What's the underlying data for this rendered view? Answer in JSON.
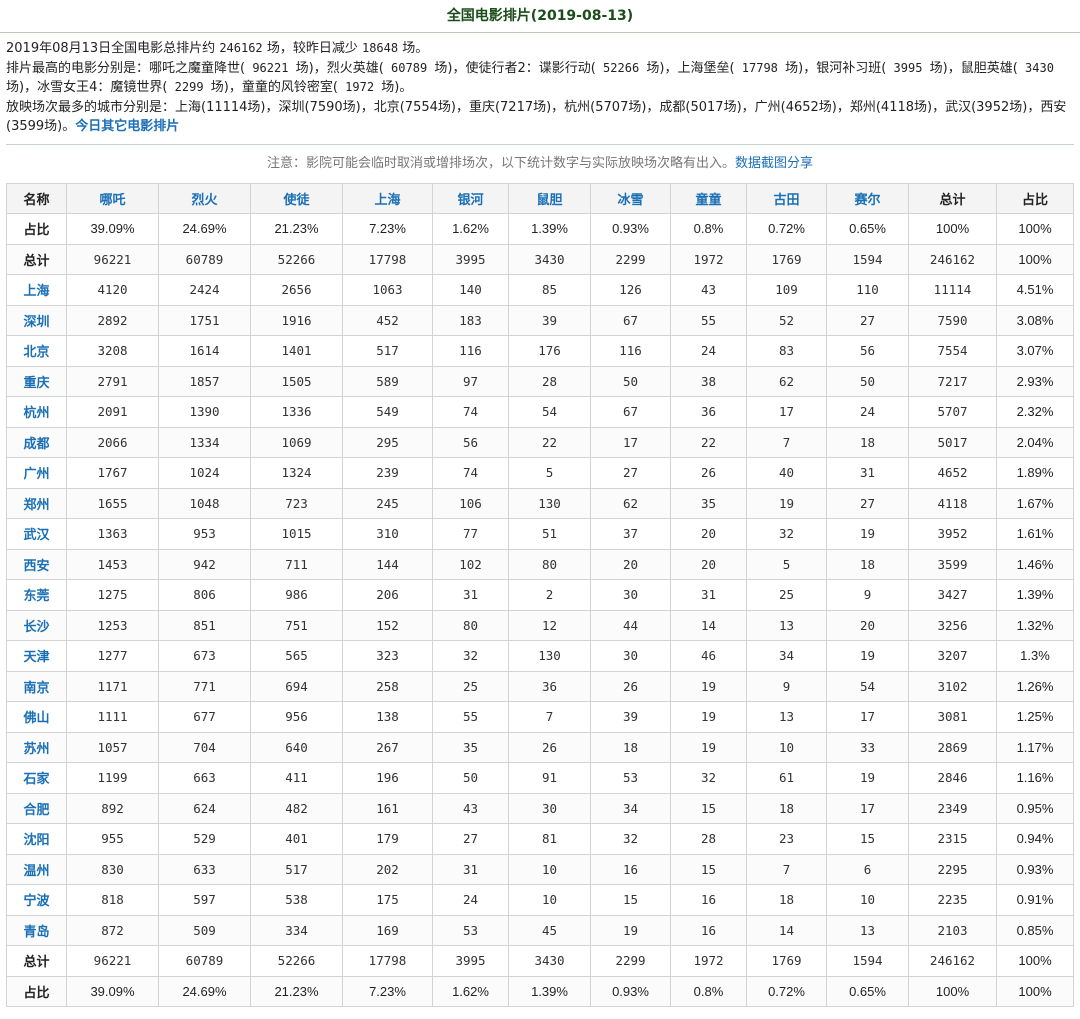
{
  "page_title": "全国电影排片(2019-08-13)",
  "summary": {
    "line1_a": "2019年08月13日全国电影总排片约",
    "total": "246162",
    "line1_b": "场，较昨日减少",
    "diff": "18648",
    "line1_c": "场。",
    "films_intro": "排片最高的电影分别是：",
    "films": [
      {
        "name": "哪吒之魔童降世",
        "count": "96221"
      },
      {
        "name": "烈火英雄",
        "count": "60789"
      },
      {
        "name": "使徒行者2：谍影行动",
        "count": "52266"
      },
      {
        "name": "上海堡垒",
        "count": "17798"
      },
      {
        "name": "银河补习班",
        "count": "3995"
      },
      {
        "name": "鼠胆英雄",
        "count": "3430"
      },
      {
        "name": "冰雪女王4：魔镜世界",
        "count": "2299"
      },
      {
        "name": "童童的风铃密室",
        "count": "1972"
      }
    ],
    "cities_line": "放映场次最多的城市分别是：上海(11114场)，深圳(7590场)，北京(7554场)，重庆(7217场)，杭州(5707场)，成都(5017场)，广州(4652场)，郑州(4118场)，武汉(3952场)，西安(3599场)。",
    "other_link": "今日其它电影排片"
  },
  "notice": {
    "text": "注意：影院可能会临时取消或增排场次，以下统计数字与实际放映场次略有出入。",
    "link": "数据截图分享"
  },
  "table": {
    "header": [
      "名称",
      "哪吒",
      "烈火",
      "使徒",
      "上海",
      "银河",
      "鼠胆",
      "冰雪",
      "童童",
      "古田",
      "赛尔",
      "总计",
      "占比"
    ],
    "top_rows": [
      {
        "label": "占比",
        "values": [
          "39.09%",
          "24.69%",
          "21.23%",
          "7.23%",
          "1.62%",
          "1.39%",
          "0.93%",
          "0.8%",
          "0.72%",
          "0.65%",
          "100%",
          "100%"
        ],
        "pct": true
      },
      {
        "label": "总计",
        "values": [
          "96221",
          "60789",
          "52266",
          "17798",
          "3995",
          "3430",
          "2299",
          "1972",
          "1769",
          "1594",
          "246162",
          "100%"
        ],
        "pct": false
      }
    ],
    "city_rows": [
      {
        "city": "上海",
        "values": [
          "4120",
          "2424",
          "2656",
          "1063",
          "140",
          "85",
          "126",
          "43",
          "109",
          "110",
          "11114"
        ],
        "share": "4.51%"
      },
      {
        "city": "深圳",
        "values": [
          "2892",
          "1751",
          "1916",
          "452",
          "183",
          "39",
          "67",
          "55",
          "52",
          "27",
          "7590"
        ],
        "share": "3.08%"
      },
      {
        "city": "北京",
        "values": [
          "3208",
          "1614",
          "1401",
          "517",
          "116",
          "176",
          "116",
          "24",
          "83",
          "56",
          "7554"
        ],
        "share": "3.07%"
      },
      {
        "city": "重庆",
        "values": [
          "2791",
          "1857",
          "1505",
          "589",
          "97",
          "28",
          "50",
          "38",
          "62",
          "50",
          "7217"
        ],
        "share": "2.93%"
      },
      {
        "city": "杭州",
        "values": [
          "2091",
          "1390",
          "1336",
          "549",
          "74",
          "54",
          "67",
          "36",
          "17",
          "24",
          "5707"
        ],
        "share": "2.32%"
      },
      {
        "city": "成都",
        "values": [
          "2066",
          "1334",
          "1069",
          "295",
          "56",
          "22",
          "17",
          "22",
          "7",
          "18",
          "5017"
        ],
        "share": "2.04%"
      },
      {
        "city": "广州",
        "values": [
          "1767",
          "1024",
          "1324",
          "239",
          "74",
          "5",
          "27",
          "26",
          "40",
          "31",
          "4652"
        ],
        "share": "1.89%"
      },
      {
        "city": "郑州",
        "values": [
          "1655",
          "1048",
          "723",
          "245",
          "106",
          "130",
          "62",
          "35",
          "19",
          "27",
          "4118"
        ],
        "share": "1.67%"
      },
      {
        "city": "武汉",
        "values": [
          "1363",
          "953",
          "1015",
          "310",
          "77",
          "51",
          "37",
          "20",
          "32",
          "19",
          "3952"
        ],
        "share": "1.61%"
      },
      {
        "city": "西安",
        "values": [
          "1453",
          "942",
          "711",
          "144",
          "102",
          "80",
          "20",
          "20",
          "5",
          "18",
          "3599"
        ],
        "share": "1.46%"
      },
      {
        "city": "东莞",
        "values": [
          "1275",
          "806",
          "986",
          "206",
          "31",
          "2",
          "30",
          "31",
          "25",
          "9",
          "3427"
        ],
        "share": "1.39%"
      },
      {
        "city": "长沙",
        "values": [
          "1253",
          "851",
          "751",
          "152",
          "80",
          "12",
          "44",
          "14",
          "13",
          "20",
          "3256"
        ],
        "share": "1.32%"
      },
      {
        "city": "天津",
        "values": [
          "1277",
          "673",
          "565",
          "323",
          "32",
          "130",
          "30",
          "46",
          "34",
          "19",
          "3207"
        ],
        "share": "1.3%"
      },
      {
        "city": "南京",
        "values": [
          "1171",
          "771",
          "694",
          "258",
          "25",
          "36",
          "26",
          "19",
          "9",
          "54",
          "3102"
        ],
        "share": "1.26%"
      },
      {
        "city": "佛山",
        "values": [
          "1111",
          "677",
          "956",
          "138",
          "55",
          "7",
          "39",
          "19",
          "13",
          "17",
          "3081"
        ],
        "share": "1.25%"
      },
      {
        "city": "苏州",
        "values": [
          "1057",
          "704",
          "640",
          "267",
          "35",
          "26",
          "18",
          "19",
          "10",
          "33",
          "2869"
        ],
        "share": "1.17%"
      },
      {
        "city": "石家",
        "values": [
          "1199",
          "663",
          "411",
          "196",
          "50",
          "91",
          "53",
          "32",
          "61",
          "19",
          "2846"
        ],
        "share": "1.16%"
      },
      {
        "city": "合肥",
        "values": [
          "892",
          "624",
          "482",
          "161",
          "43",
          "30",
          "34",
          "15",
          "18",
          "17",
          "2349"
        ],
        "share": "0.95%"
      },
      {
        "city": "沈阳",
        "values": [
          "955",
          "529",
          "401",
          "179",
          "27",
          "81",
          "32",
          "28",
          "23",
          "15",
          "2315"
        ],
        "share": "0.94%"
      },
      {
        "city": "温州",
        "values": [
          "830",
          "633",
          "517",
          "202",
          "31",
          "10",
          "16",
          "15",
          "7",
          "6",
          "2295"
        ],
        "share": "0.93%"
      },
      {
        "city": "宁波",
        "values": [
          "818",
          "597",
          "538",
          "175",
          "24",
          "10",
          "15",
          "16",
          "18",
          "10",
          "2235"
        ],
        "share": "0.91%"
      },
      {
        "city": "青岛",
        "values": [
          "872",
          "509",
          "334",
          "169",
          "53",
          "45",
          "19",
          "16",
          "14",
          "13",
          "2103"
        ],
        "share": "0.85%"
      }
    ],
    "bottom_rows": [
      {
        "label": "总计",
        "values": [
          "96221",
          "60789",
          "52266",
          "17798",
          "3995",
          "3430",
          "2299",
          "1972",
          "1769",
          "1594",
          "246162",
          "100%"
        ],
        "pct": false
      },
      {
        "label": "占比",
        "values": [
          "39.09%",
          "24.69%",
          "21.23%",
          "7.23%",
          "1.62%",
          "1.39%",
          "0.93%",
          "0.8%",
          "0.72%",
          "0.65%",
          "100%",
          "100%"
        ],
        "pct": true
      }
    ]
  }
}
